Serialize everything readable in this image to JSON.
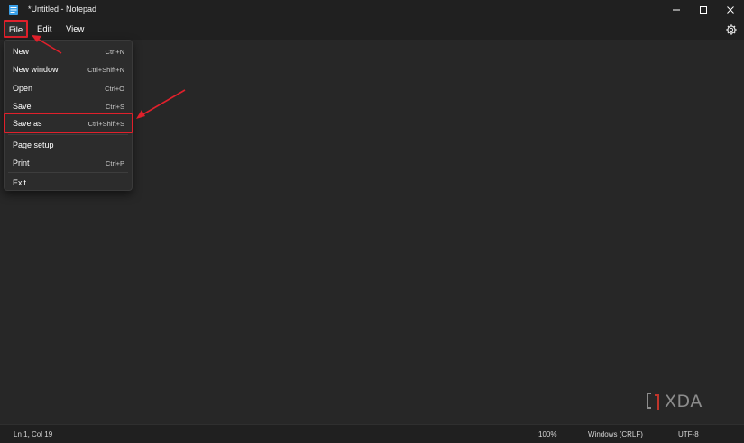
{
  "window": {
    "title": "*Untitled - Notepad"
  },
  "menubar": {
    "file": "File",
    "edit": "Edit",
    "view": "View"
  },
  "file_menu": {
    "items": [
      {
        "label": "New",
        "shortcut": "Ctrl+N"
      },
      {
        "label": "New window",
        "shortcut": "Ctrl+Shift+N"
      },
      {
        "label": "Open",
        "shortcut": "Ctrl+O"
      },
      {
        "label": "Save",
        "shortcut": "Ctrl+S"
      },
      {
        "label": "Save as",
        "shortcut": "Ctrl+Shift+S"
      },
      {
        "label": "Page setup",
        "shortcut": ""
      },
      {
        "label": "Print",
        "shortcut": "Ctrl+P"
      },
      {
        "label": "Exit",
        "shortcut": ""
      }
    ]
  },
  "statusbar": {
    "position": "Ln 1, Col 19",
    "zoom": "100%",
    "line_ending": "Windows (CRLF)",
    "encoding": "UTF-8"
  },
  "watermark": {
    "text": "XDA"
  },
  "colors": {
    "highlight_red": "#e0202b",
    "background": "#272727",
    "menu_background": "#2c2c2c"
  },
  "icons": {
    "app": "notepad-icon",
    "settings": "gear-icon",
    "minimize": "minimize-icon",
    "maximize": "maximize-icon",
    "close": "close-icon"
  }
}
